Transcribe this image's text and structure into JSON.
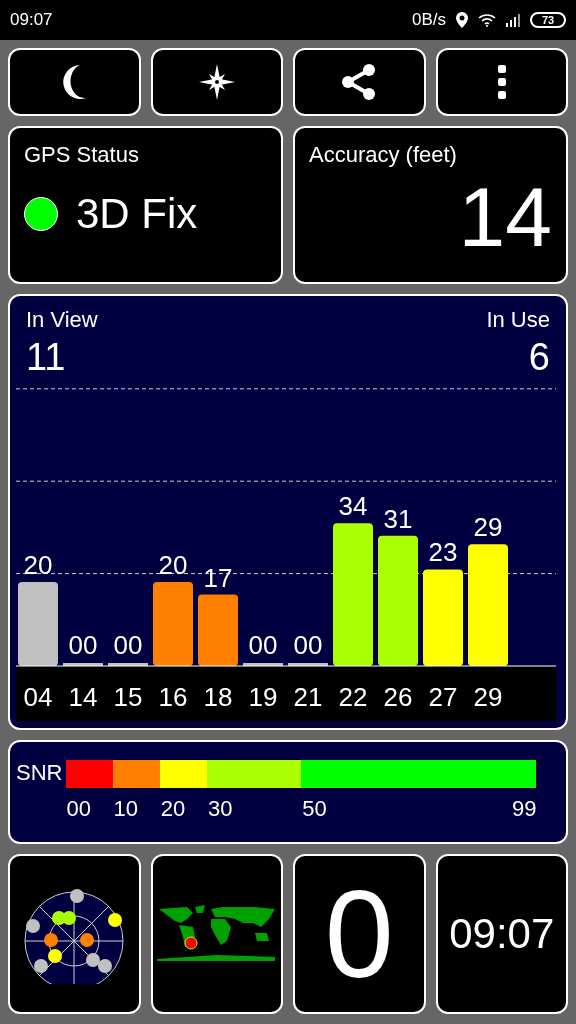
{
  "status_bar": {
    "time": "09:07",
    "speed": "0B/s",
    "battery": "73"
  },
  "toolbar": [
    {
      "kind": "moon"
    },
    {
      "kind": "compass"
    },
    {
      "kind": "share"
    },
    {
      "kind": "more"
    }
  ],
  "gps_status": {
    "title": "GPS Status",
    "value": "3D Fix",
    "color": "#00ff00"
  },
  "accuracy": {
    "title": "Accuracy (feet)",
    "value": "14"
  },
  "satellites": {
    "in_view_label": "In View",
    "in_view": "11",
    "in_use_label": "In Use",
    "in_use": "6",
    "chart_data": {
      "type": "bar",
      "categories": [
        "04",
        "14",
        "15",
        "16",
        "18",
        "19",
        "21",
        "22",
        "26",
        "27",
        "29"
      ],
      "series": [
        {
          "color": "#c0c0c0",
          "values": [
            20,
            0,
            0,
            null,
            null,
            0,
            0,
            null,
            null,
            null,
            null
          ],
          "value_labels": [
            "20",
            "00",
            "00",
            null,
            null,
            "00",
            "00",
            null,
            null,
            null,
            null
          ]
        },
        {
          "color": "#ff8000",
          "values": [
            null,
            null,
            null,
            20,
            17,
            null,
            null,
            null,
            null,
            null,
            null
          ],
          "value_labels": [
            null,
            null,
            null,
            "20",
            "17",
            null,
            null,
            null,
            null,
            null,
            null
          ]
        },
        {
          "color": "#aaff00",
          "values": [
            null,
            null,
            null,
            null,
            null,
            null,
            null,
            34,
            31,
            null,
            null
          ],
          "value_labels": [
            null,
            null,
            null,
            null,
            null,
            null,
            null,
            "34",
            "31",
            null,
            null
          ]
        },
        {
          "color": "#ffff00",
          "values": [
            null,
            null,
            null,
            null,
            null,
            null,
            null,
            null,
            null,
            23,
            29
          ],
          "value_labels": [
            null,
            null,
            null,
            null,
            null,
            null,
            null,
            null,
            null,
            "23",
            "29"
          ]
        }
      ],
      "data_labels": true
    }
  },
  "snr_legend": {
    "label": "SNR",
    "segments": [
      {
        "label": "00",
        "color": "#ff0000"
      },
      {
        "label": "10",
        "color": "#ff8000"
      },
      {
        "label": "20",
        "color": "#ffff00"
      },
      {
        "label": "30",
        "color": "#aaff00"
      },
      {
        "label": "50",
        "color": "#00ff00"
      }
    ],
    "end_label": "99"
  },
  "bottom": {
    "speed": "0",
    "clock": "09:07"
  }
}
